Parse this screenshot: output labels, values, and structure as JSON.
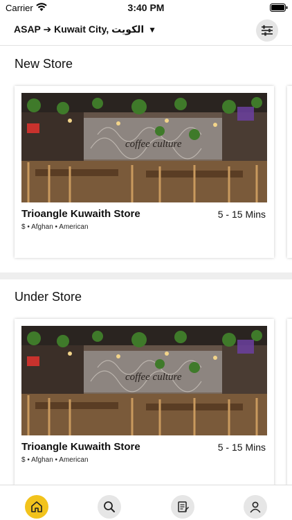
{
  "status_bar": {
    "carrier": "Carrier",
    "time": "3:40 PM"
  },
  "header": {
    "location_text": "ASAP ➔ Kuwait City, الكويت",
    "dropdown_icon": "chevron-down-icon",
    "filter_icon": "filter-sliders-icon"
  },
  "sections": [
    {
      "title": "New Store",
      "store": {
        "name": "Trioangle Kuwaith Store",
        "delivery_time": "5 - 15 Mins",
        "tags": "$ • Afghan • American",
        "image_sign_text": "coffee culture"
      }
    },
    {
      "title": "Under Store",
      "store": {
        "name": "Trioangle Kuwaith Store",
        "delivery_time": "5 - 15 Mins",
        "tags": "$ • Afghan • American",
        "image_sign_text": "coffee culture"
      }
    }
  ],
  "bottom_nav": {
    "items": [
      "home-icon",
      "search-icon",
      "orders-icon",
      "profile-icon"
    ],
    "active_color": "#f2c31c",
    "inactive_color": "#e6e6e6"
  }
}
